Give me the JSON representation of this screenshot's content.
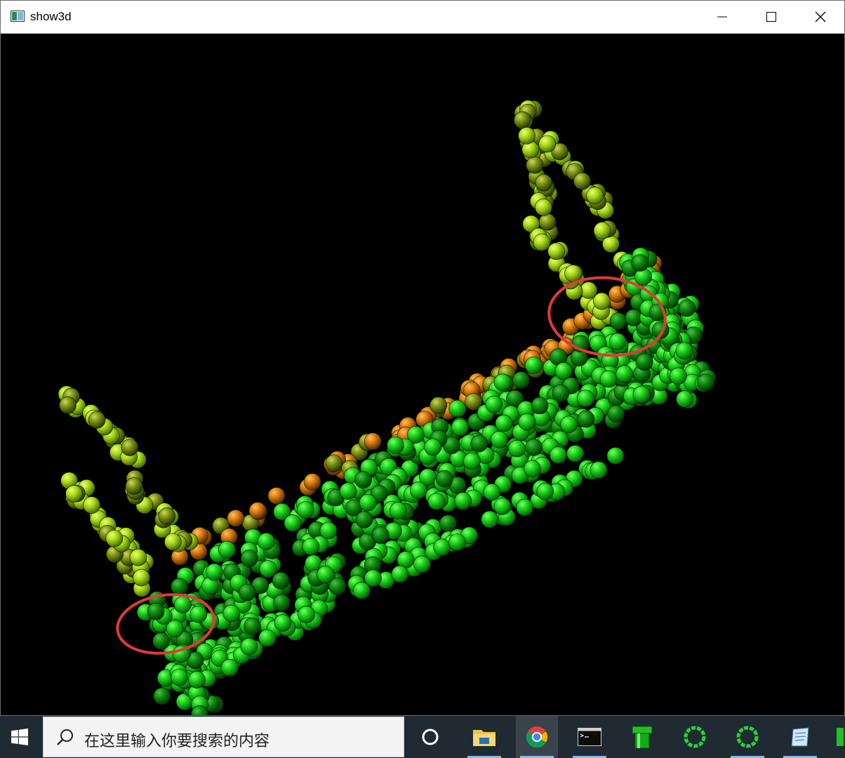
{
  "window": {
    "title": "show3d",
    "icons": [
      "app-icon",
      "minimize-icon",
      "maximize-icon",
      "close-icon"
    ]
  },
  "viewport": {
    "background": "#000000",
    "marker_color": "#e03a3a",
    "point_colors": {
      "green": "#16d416",
      "dark_green": "#0a8a0a",
      "yellow_green": "#a8d818",
      "olive": "#7c9010",
      "orange": "#d97a0a"
    }
  },
  "taskbar": {
    "search_placeholder": "在这里输入你要搜索的内容",
    "items": [
      "windows-start-icon",
      "search-icon",
      "cortana-icon",
      "file-explorer-icon",
      "chrome-icon",
      "terminal-icon",
      "green-pipe-icon",
      "loading-ring-icon",
      "loading-ring-icon-2",
      "notepad-icon"
    ]
  }
}
